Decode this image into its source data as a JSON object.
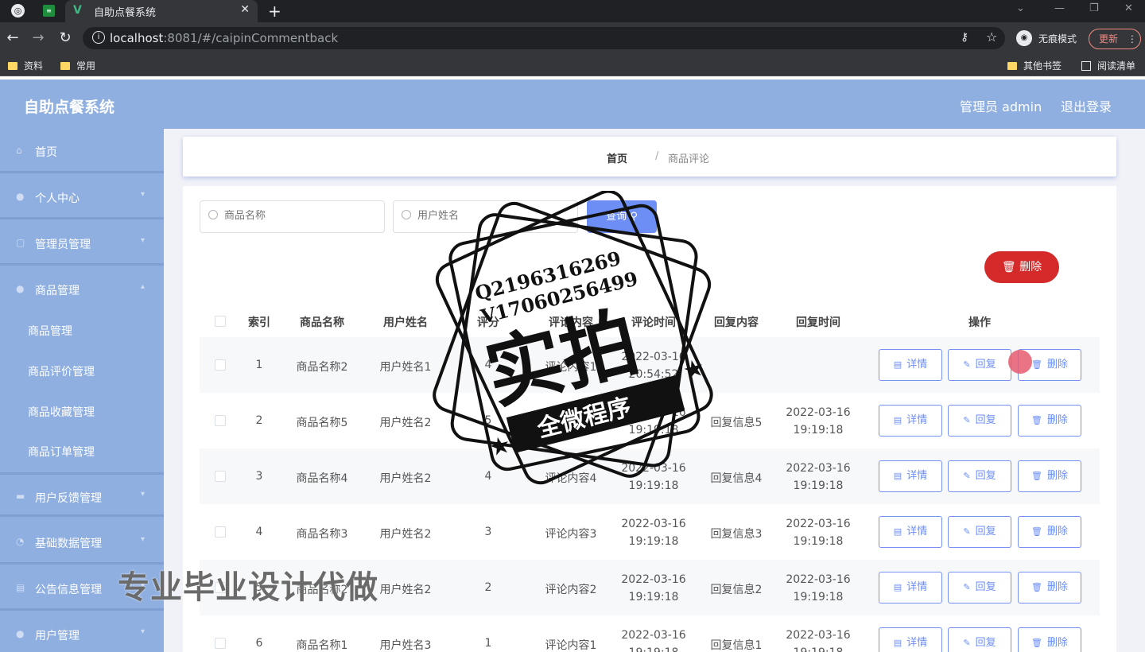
{
  "browser": {
    "tab_title": "自助点餐系统",
    "url_host": "localhost",
    "url_rest": ":8081/#/caipinCommentback",
    "incognito_label": "无痕模式",
    "update_label": "更新",
    "bookmarks": [
      "资料",
      "常用"
    ],
    "other_bookmarks": "其他书签",
    "reading_list": "阅读清单"
  },
  "header": {
    "title": "自助点餐系统",
    "admin": "管理员 admin",
    "logout": "退出登录"
  },
  "sidebar": {
    "items": [
      {
        "label": "首页",
        "icon": "home-icon"
      },
      {
        "label": "个人中心",
        "icon": "user-icon"
      },
      {
        "label": "管理员管理",
        "icon": "admin-icon"
      },
      {
        "label": "商品管理",
        "icon": "user-icon"
      },
      {
        "label": "用户反馈管理",
        "icon": "feedback-icon"
      },
      {
        "label": "基础数据管理",
        "icon": "data-icon"
      },
      {
        "label": "公告信息管理",
        "icon": "notice-icon"
      },
      {
        "label": "用户管理",
        "icon": "user-icon"
      }
    ],
    "sub_items": [
      "商品管理",
      "商品评价管理",
      "商品收藏管理",
      "商品订单管理"
    ]
  },
  "breadcrumb": {
    "home": "首页",
    "sep": "/",
    "current": "商品评论"
  },
  "search": {
    "goods_placeholder": "商品名称",
    "user_placeholder": "用户姓名",
    "query_label": "查询"
  },
  "delete_label": "删除",
  "table": {
    "headers": [
      "索引",
      "商品名称",
      "用户姓名",
      "评分",
      "评论内容",
      "评论时间",
      "回复内容",
      "回复时间",
      "操作"
    ],
    "rows": [
      {
        "index": "1",
        "goods": "商品名称2",
        "user": "用户姓名1",
        "score": "4",
        "content": "评论内容1",
        "time_date": "2022-03-16",
        "time_clock": "20:54:52",
        "reply": "",
        "reply_date": "",
        "reply_clock": ""
      },
      {
        "index": "2",
        "goods": "商品名称5",
        "user": "用户姓名2",
        "score": "5",
        "content": "评论内容5",
        "time_date": "2022-03-16",
        "time_clock": "19:19:18",
        "reply": "回复信息5",
        "reply_date": "2022-03-16",
        "reply_clock": "19:19:18"
      },
      {
        "index": "3",
        "goods": "商品名称4",
        "user": "用户姓名2",
        "score": "4",
        "content": "评论内容4",
        "time_date": "2022-03-16",
        "time_clock": "19:19:18",
        "reply": "回复信息4",
        "reply_date": "2022-03-16",
        "reply_clock": "19:19:18"
      },
      {
        "index": "4",
        "goods": "商品名称3",
        "user": "用户姓名2",
        "score": "3",
        "content": "评论内容3",
        "time_date": "2022-03-16",
        "time_clock": "19:19:18",
        "reply": "回复信息3",
        "reply_date": "2022-03-16",
        "reply_clock": "19:19:18"
      },
      {
        "index": "5",
        "goods": "商品名称2",
        "user": "用户姓名2",
        "score": "2",
        "content": "评论内容2",
        "time_date": "2022-03-16",
        "time_clock": "19:19:18",
        "reply": "回复信息2",
        "reply_date": "2022-03-16",
        "reply_clock": "19:19:18"
      },
      {
        "index": "6",
        "goods": "商品名称1",
        "user": "用户姓名3",
        "score": "1",
        "content": "评论内容1",
        "time_date": "2022-03-16",
        "time_clock": "19:19:18",
        "reply": "回复信息1",
        "reply_date": "2022-03-16",
        "reply_clock": "19:19:18"
      }
    ],
    "actions": {
      "detail": "详情",
      "reply": "回复",
      "delete": "删除"
    }
  },
  "watermark": {
    "qq": "Q2196316269",
    "vx": "V17060256499",
    "big": "实拍",
    "banner": "全微程序",
    "bottom": "专业毕业设计代做"
  },
  "colors": {
    "primary": "#6d8ef5",
    "sidebar": "#8fafe0",
    "danger": "#d42a2a"
  }
}
